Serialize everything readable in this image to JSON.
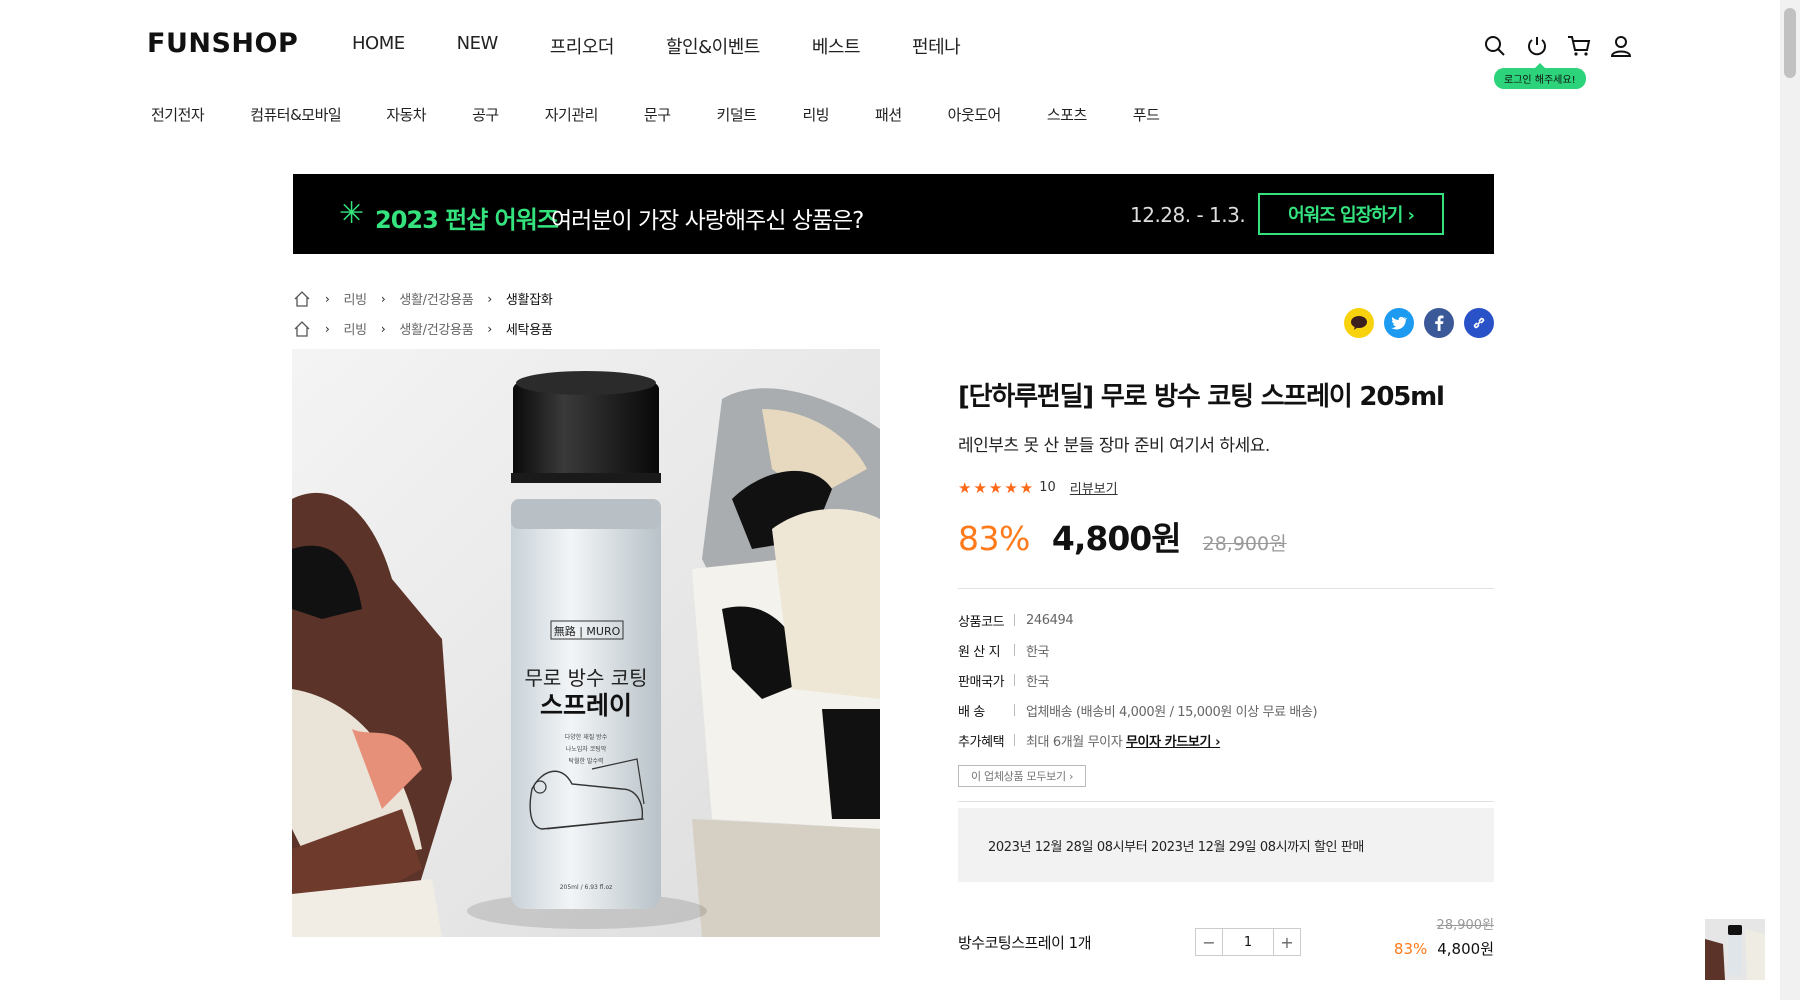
{
  "header": {
    "logo": "FUNSHOP",
    "gnb": [
      "HOME",
      "NEW",
      "프리오더",
      "할인&이벤트",
      "베스트",
      "펀테나"
    ],
    "login_tip": "로그인 해주세요!",
    "icons": [
      "search-icon",
      "power-icon",
      "cart-icon",
      "user-icon"
    ]
  },
  "categories": [
    "전기전자",
    "컴퓨터&모바일",
    "자동차",
    "공구",
    "자기관리",
    "문구",
    "키덜트",
    "리빙",
    "패션",
    "아웃도어",
    "스포츠",
    "푸드"
  ],
  "banner": {
    "star": "✳",
    "title": "2023 펀샵 어워즈",
    "subtitle": "여러분이 가장 사랑해주신 상품은?",
    "date": "12.28. - 1.3.",
    "button": "어워즈 입장하기 ›"
  },
  "breadcrumbs": [
    [
      "리빙",
      "생활/건강용품",
      "생활잡화"
    ],
    [
      "리빙",
      "생활/건강용품",
      "세탁용품"
    ]
  ],
  "share": [
    "kakao-icon",
    "twitter-icon",
    "facebook-icon",
    "link-icon"
  ],
  "product": {
    "name": "[단하루펀딜] 무로 방수 코팅 스프레이 205ml",
    "description": "레인부츠 못 산 분들 장마 준비 여기서 하세요.",
    "rating_count": "10",
    "review_link": "리뷰보기",
    "discount": "83%",
    "price": "4,800원",
    "original_price": "28,900원",
    "specs": [
      {
        "k": "상품코드",
        "v": "246494"
      },
      {
        "k": "원 산 지",
        "v": "한국"
      },
      {
        "k": "판매국가",
        "v": "한국"
      },
      {
        "k": "배 송",
        "v": "업체배송 (배송비 4,000원 / 15,000원 이상 무료 배송)"
      }
    ],
    "benefit_key": "추가혜택",
    "benefit_text": "최대 6개월 무이자",
    "benefit_link": "무이자 카드보기 ›",
    "all_products_button": "이 업체상품 모두보기 ›",
    "notice": "2023년 12월 28일 08시부터 2023년 12월 29일 08시까지 할인 판매",
    "can_label": "無路 | MURO",
    "can_title1": "무로 방수 코팅",
    "can_title2": "스프레이",
    "can_small": [
      "다양한 재질 방수",
      "나노입자 코팅막",
      "탁월한 발수력"
    ],
    "can_volume": "205ml / 6.93 fl.oz"
  },
  "option": {
    "name": "방수코팅스프레이 1개",
    "qty": "1",
    "minus": "−",
    "plus": "+",
    "original_price": "28,900원",
    "discount": "83%",
    "price": "4,800원"
  }
}
